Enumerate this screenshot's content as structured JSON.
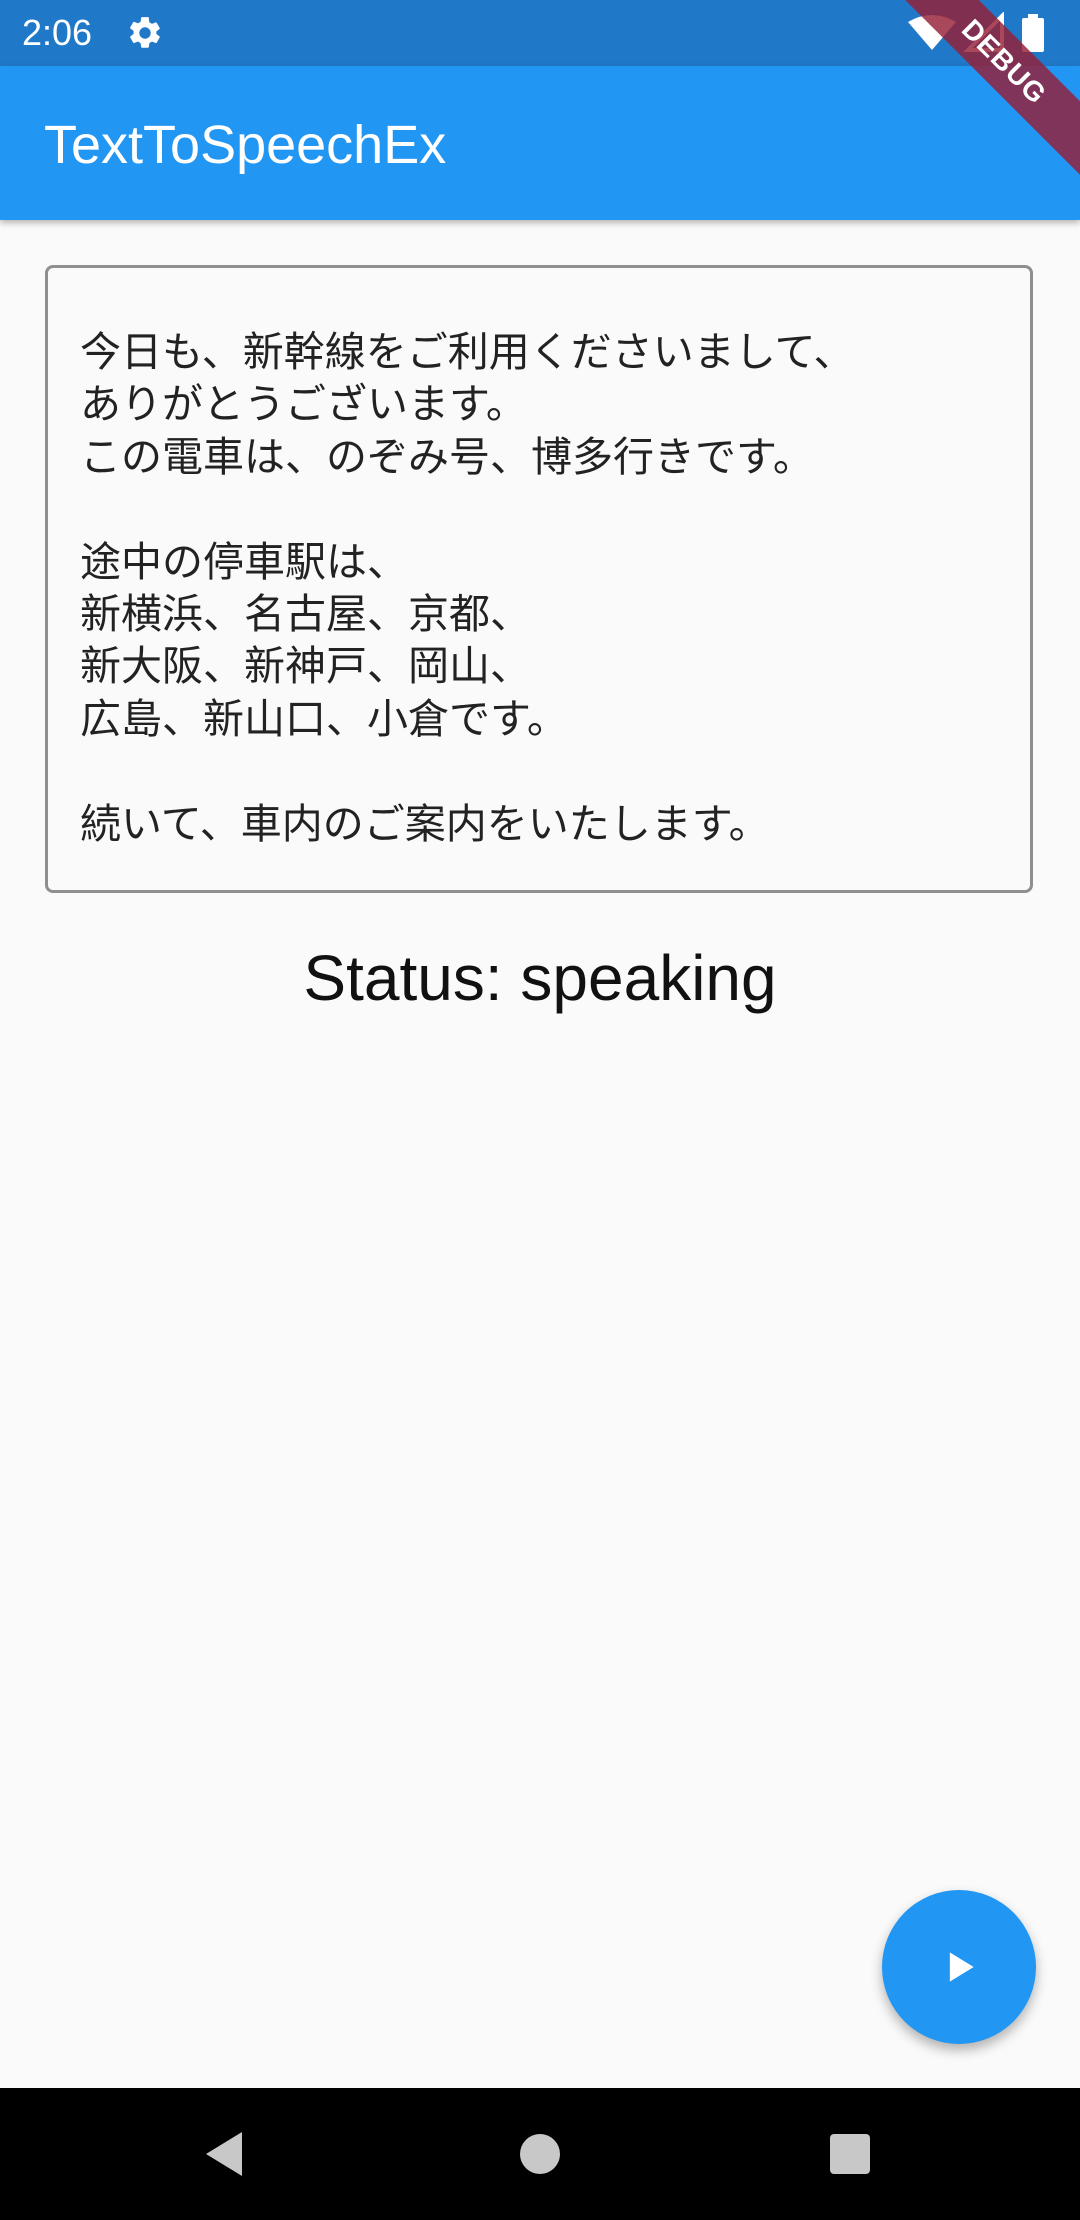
{
  "status_bar": {
    "time": "2:06",
    "icons": [
      "gear-icon",
      "wifi-icon",
      "signal-icon",
      "battery-icon"
    ]
  },
  "app_bar": {
    "title": "TextToSpeechEx",
    "debug_label": "DEBUG"
  },
  "main": {
    "speech_text": "今日も、新幹線をご利用くださいまして、\nありがとうございます。\nこの電車は、のぞみ号、博多行きです。\n\n途中の停車駅は、\n新横浜、名古屋、京都、\n新大阪、新神戸、岡山、\n広島、新山口、小倉です。\n\n続いて、車内のご案内をいたします。",
    "status_text": "Status: speaking"
  },
  "fab": {
    "icon": "play-icon"
  },
  "nav_bar": {
    "icons": [
      "back-icon",
      "home-icon",
      "recents-icon"
    ]
  },
  "colors": {
    "status_bar": "#1f78c8",
    "app_bar": "#2196f3",
    "fab": "#2196f3",
    "background": "#fafafa",
    "nav_bar": "#000000",
    "debug_ribbon": "#961e37"
  }
}
